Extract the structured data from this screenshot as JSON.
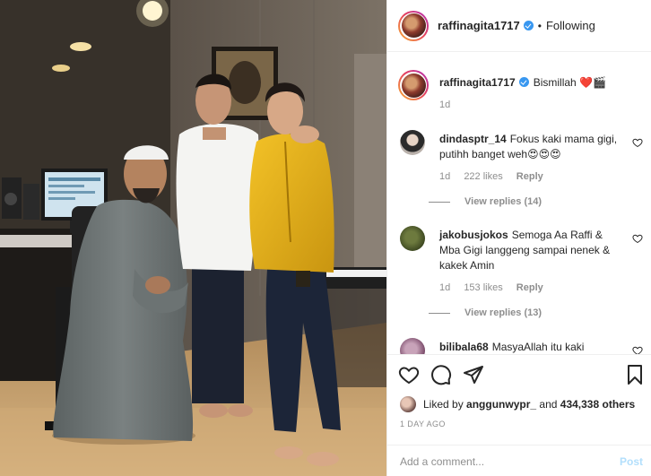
{
  "post": {
    "username": "raffinagita1717",
    "follow_status": "Following",
    "separator": "•"
  },
  "caption": {
    "username": "raffinagita1717",
    "text": "Bismillah",
    "emojis": "❤️🎬",
    "time": "1d"
  },
  "comments": [
    {
      "username": "dindasptr_14",
      "text": "Fokus kaki mama gigi, putihh banget weh😍😍😍",
      "time": "1d",
      "likes": "222 likes",
      "reply_label": "Reply",
      "view_replies": "View replies (14)"
    },
    {
      "username": "jakobusjokos",
      "text": "Semoga Aa Raffi & Mba Gigi langgeng sampai nenek & kakek Amin",
      "time": "1d",
      "likes": "153 likes",
      "reply_label": "Reply",
      "view_replies": "View replies (13)"
    },
    {
      "username": "bilibala68",
      "text": "MasyaAllah itu kaki"
    }
  ],
  "likes_summary": {
    "prefix": "Liked by",
    "user": "anggunwypr_",
    "joiner": "and",
    "others": "434,338 others"
  },
  "timestamp": "1 DAY AGO",
  "add_comment": {
    "placeholder": "Add a comment...",
    "post_label": "Post"
  },
  "colors": {
    "accent_blue": "#3897f0",
    "post_disabled": "#b2dffc",
    "muted_text": "#8e8e8e",
    "border": "#efefef"
  },
  "icons": [
    "heart-icon",
    "comment-icon",
    "share-icon",
    "bookmark-icon",
    "verified-icon"
  ]
}
